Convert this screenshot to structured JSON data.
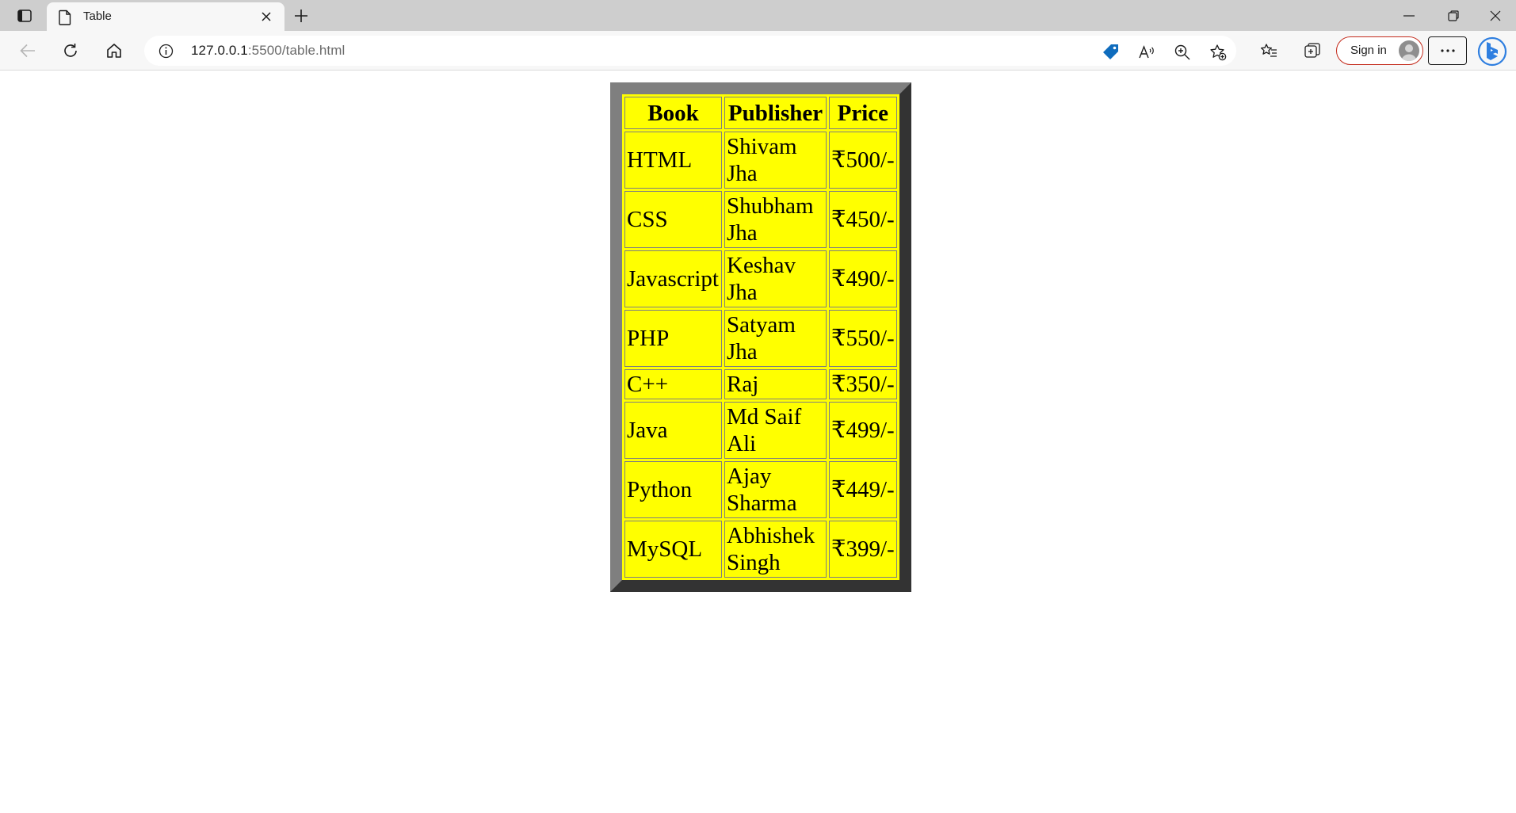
{
  "browser": {
    "tab": {
      "title": "Table"
    },
    "address_bar": {
      "host": "127.0.0.1",
      "rest": ":5500/table.html"
    },
    "sign_in_label": "Sign in"
  },
  "table": {
    "headers": [
      "Book",
      "Publisher",
      "Price"
    ],
    "rows": [
      {
        "book": "HTML",
        "publisher": "Shivam Jha",
        "price": "₹500/-"
      },
      {
        "book": "CSS",
        "publisher": "Shubham Jha",
        "price": "₹450/-"
      },
      {
        "book": "Javascript",
        "publisher": "Keshav Jha",
        "price": "₹490/-"
      },
      {
        "book": "PHP",
        "publisher": "Satyam Jha",
        "price": "₹550/-"
      },
      {
        "book": "C++",
        "publisher": "Raj",
        "price": "₹350/-"
      },
      {
        "book": "Java",
        "publisher": "Md Saif Ali",
        "price": "₹499/-"
      },
      {
        "book": "Python",
        "publisher": "Ajay Sharma",
        "price": "₹449/-"
      },
      {
        "book": "MySQL",
        "publisher": "Abhishek Singh",
        "price": "₹399/-"
      }
    ]
  }
}
